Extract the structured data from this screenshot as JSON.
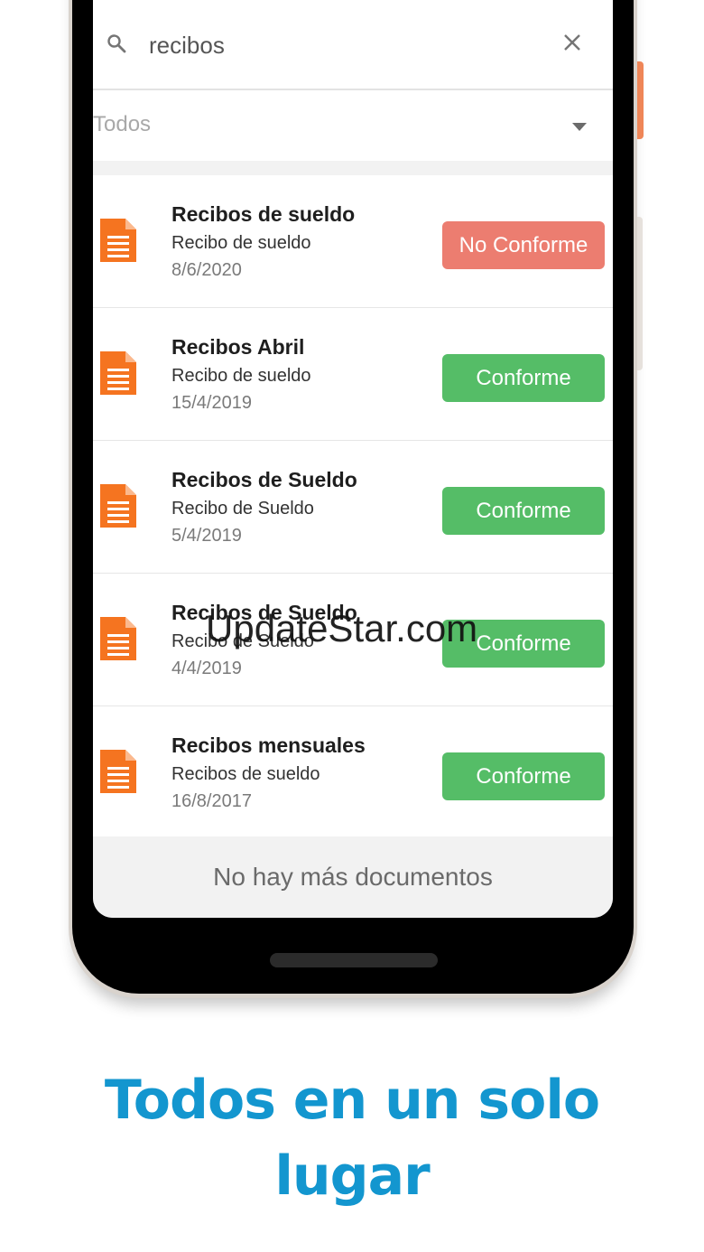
{
  "search": {
    "value": "recibos",
    "icon": "search-icon",
    "clear_icon": "close-icon"
  },
  "filter": {
    "selected": "Todos",
    "icon": "dropdown-arrow-icon"
  },
  "documents": [
    {
      "title": "Recibos de sueldo",
      "subtitle": "Recibo de sueldo",
      "date": "8/6/2020",
      "status": "No Conforme",
      "status_color": "#ec7d70"
    },
    {
      "title": "Recibos Abril",
      "subtitle": "Recibo de sueldo",
      "date": "15/4/2019",
      "status": "Conforme",
      "status_color": "#55bd67"
    },
    {
      "title": "Recibos de Sueldo",
      "subtitle": "Recibo de Sueldo",
      "date": "5/4/2019",
      "status": "Conforme",
      "status_color": "#55bd67"
    },
    {
      "title": "Recibos de Sueldo",
      "subtitle": "Recibo de Sueldo",
      "date": "4/4/2019",
      "status": "Conforme",
      "status_color": "#55bd67"
    },
    {
      "title": "Recibos mensuales",
      "subtitle": "Recibos de sueldo",
      "date": "16/8/2017",
      "status": "Conforme",
      "status_color": "#55bd67"
    }
  ],
  "footer": {
    "message": "No hay más documentos"
  },
  "watermark": "UpdateStar.com",
  "tagline": {
    "line1": "Todos en un solo",
    "line2": "lugar"
  },
  "colors": {
    "doc_icon": "#f57420",
    "tagline": "#1396cf"
  }
}
